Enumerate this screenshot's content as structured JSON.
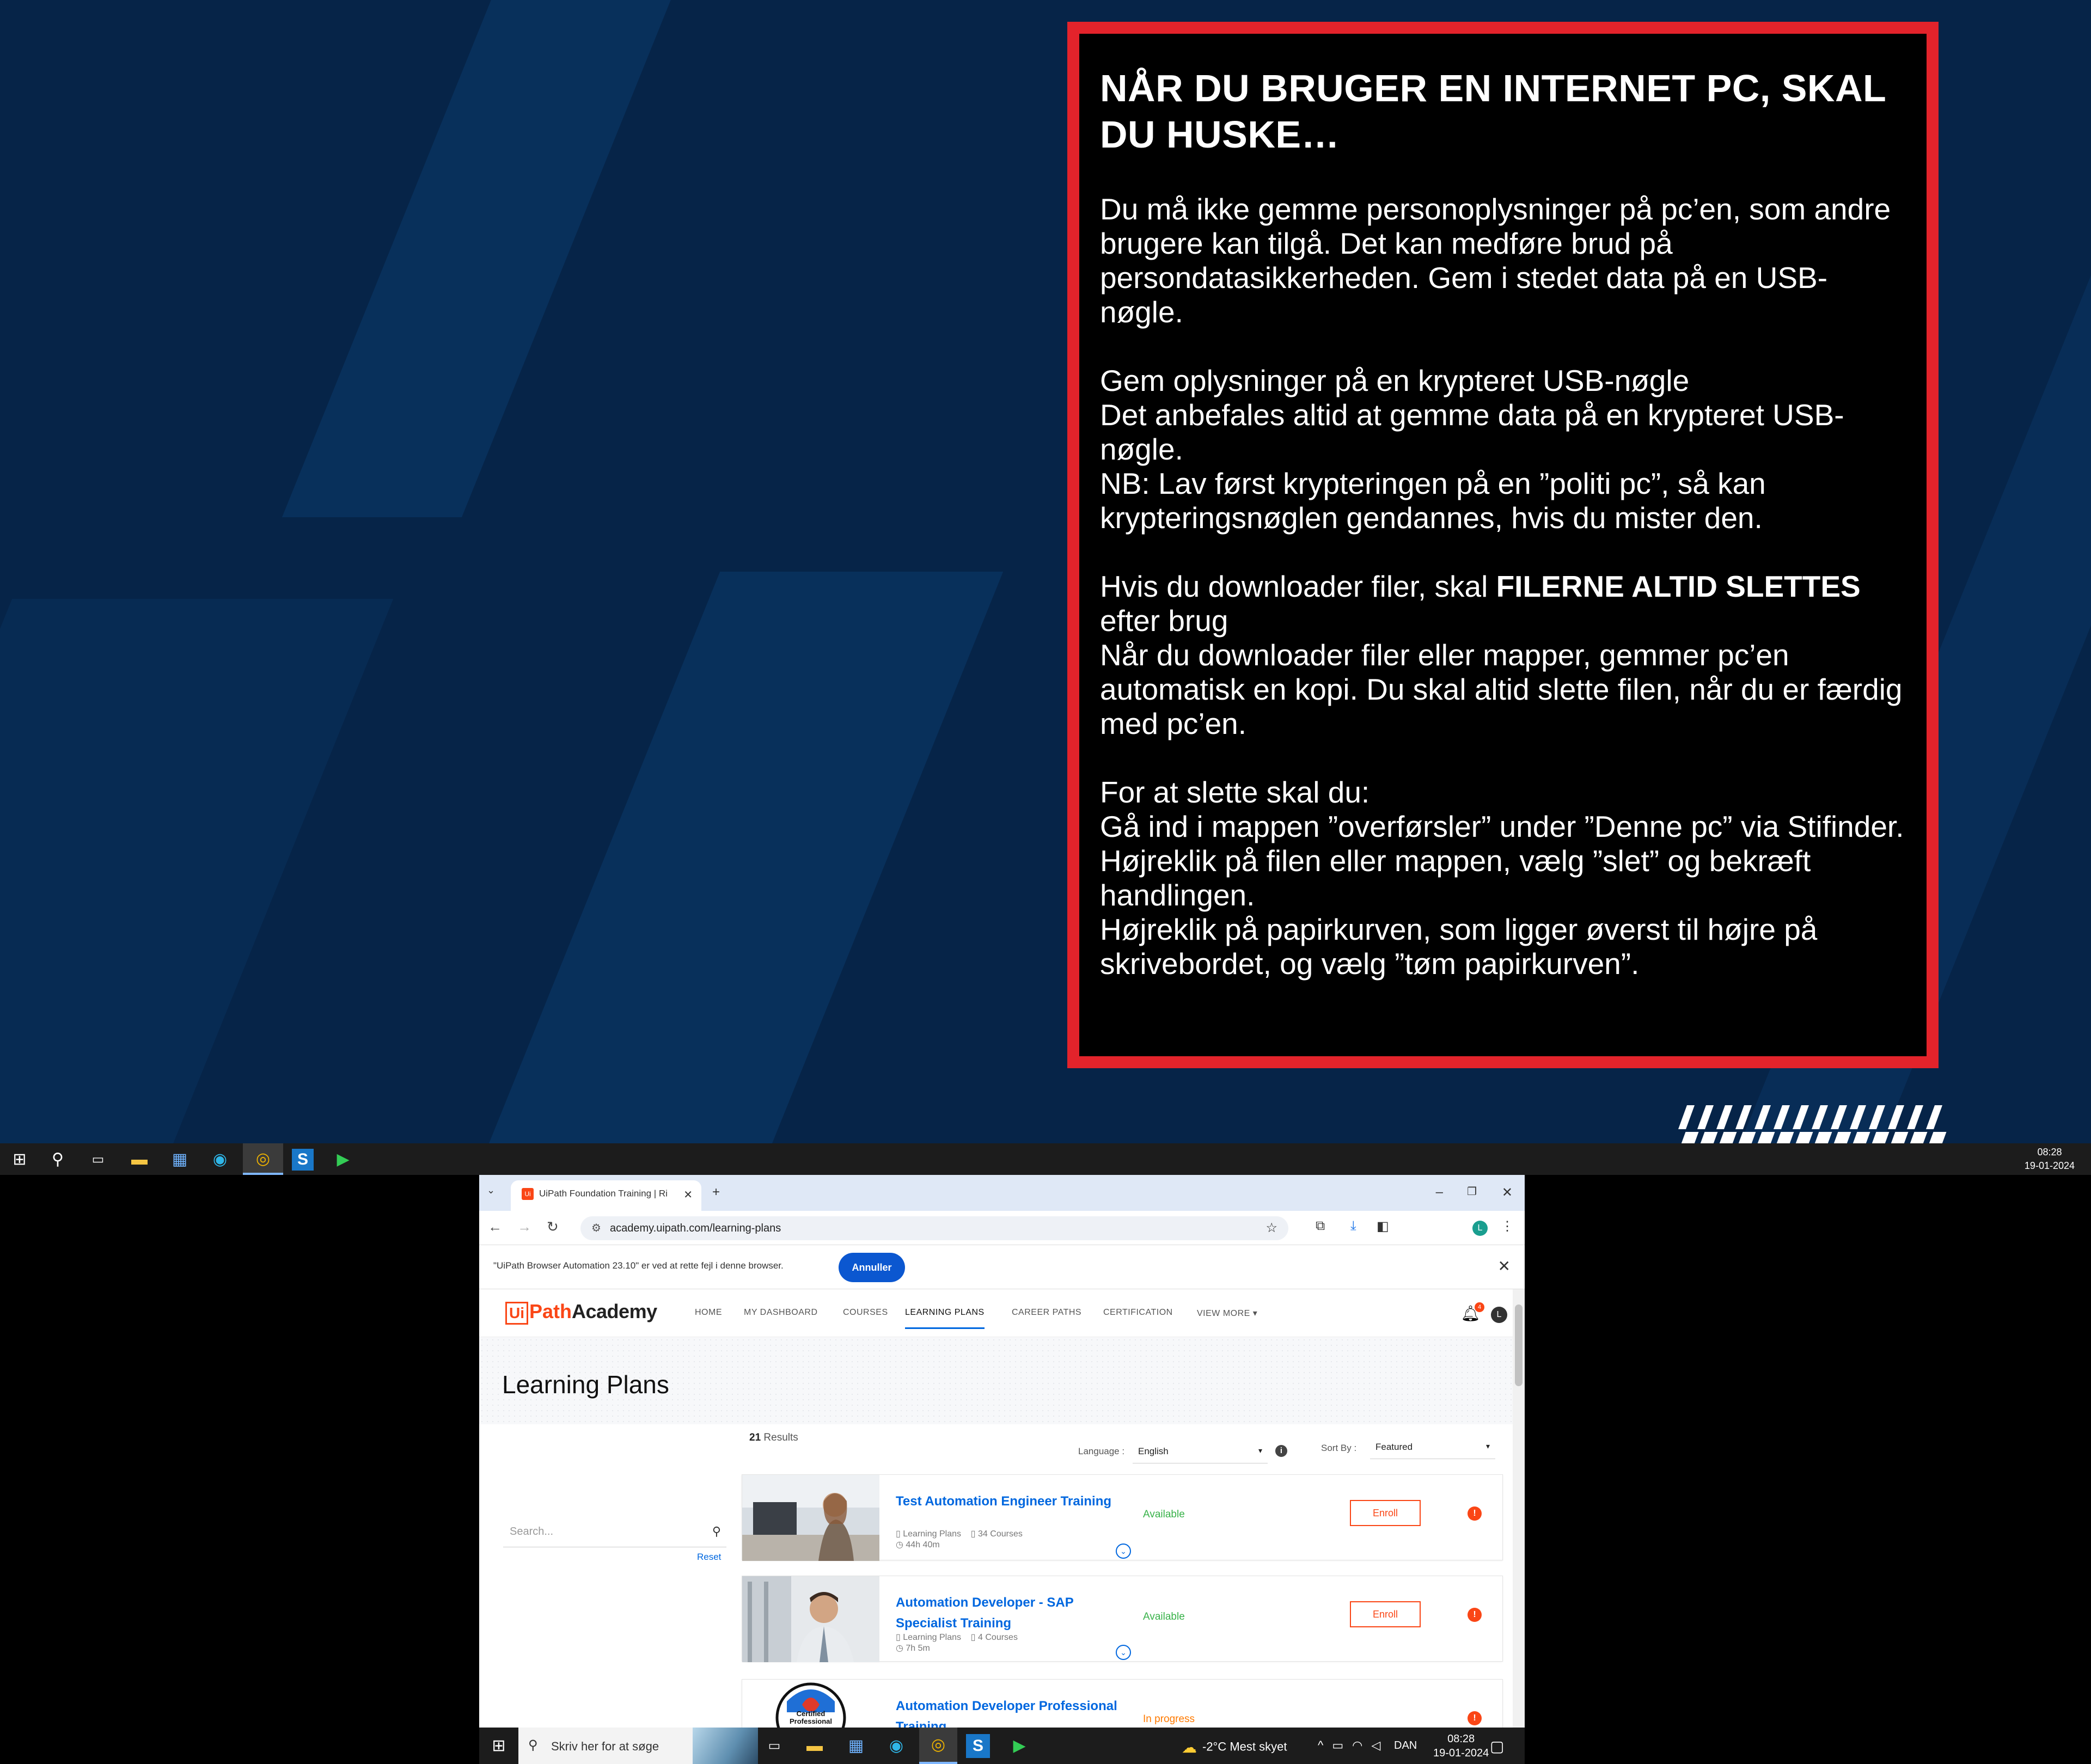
{
  "desktop_top": {
    "notice": {
      "title": "NÅR DU BRUGER EN INTERNET PC, SKAL DU HUSKE…",
      "p1": "Du må ikke gemme personoplysninger på pc’en, som andre brugere kan tilgå. Det kan medføre brud på persondatasikkerheden. Gem i stedet data på en USB-nøgle.",
      "p2_l1": "Gem oplysninger på en krypteret USB-nøgle",
      "p2_l2": "Det anbefales altid at gemme data på en krypteret USB-nøgle.",
      "p2_l3": "NB: Lav først krypteringen på en ”politi pc”, så kan krypteringsnøglen gendannes, hvis du mister den.",
      "p3_pre": "Hvis du downloader filer, skal ",
      "p3_bold": "FILERNE ALTID SLETTES",
      "p3_post": " efter brug",
      "p3_l2": "Når du downloader filer eller mapper, gemmer pc’en automatisk en kopi. Du skal altid slette filen, når du er færdig med pc’en.",
      "p4_l1": "For at slette skal du:",
      "p4_l2": "Gå ind i mappen ”overførsler” under ”Denne pc” via Stifinder.",
      "p4_l3": "Højreklik på filen eller mappen, vælg ”slet” og bekræft handlingen.",
      "p4_l4": "Højreklik på papirkurven, som ligger øverst til højre på skrivebordet, og vælg ”tøm papirkurven”."
    },
    "taskbar": {
      "icons": [
        "windows-icon",
        "search-icon",
        "task-view-icon",
        "file-explorer-icon",
        "store-icon",
        "edge-icon",
        "chrome-icon",
        "app-s-icon",
        "media-player-icon"
      ],
      "time": "08:28",
      "date": "19-01-2024"
    }
  },
  "browser": {
    "tab_title": "UiPath Foundation Training | Ri",
    "tab_favicon": "Ui",
    "new_tab": "+",
    "url": "academy.uipath.com/learning-plans",
    "profile_initial": "L",
    "infobar_text": "\"UiPath Browser Automation 23.10\" er ved at rette fejl i denne browser.",
    "infobar_button": "Annuller"
  },
  "site": {
    "logo_ui": "Ui",
    "logo_path": "Path",
    "logo_academy": "Academy",
    "nav": {
      "home": "HOME",
      "dashboard": "MY DASHBOARD",
      "courses": "COURSES",
      "learning_plans": "LEARNING PLANS",
      "career_paths": "CAREER PATHS",
      "certification": "CERTIFICATION",
      "view_more": "VIEW MORE ▾"
    },
    "notification_count": "4",
    "user_initial": "L",
    "page_title": "Learning Plans",
    "search_placeholder": "Search...",
    "reset": "Reset",
    "results_count": "21",
    "results_label": " Results",
    "language_label": "Language :",
    "language_value": "English",
    "sort_label": "Sort By :",
    "sort_value": "Featured",
    "cards": [
      {
        "title": "Test Automation Engineer Training",
        "type": "Learning Plans",
        "courses": "34 Courses",
        "duration": "44h 40m",
        "status": "Available",
        "action": "Enroll"
      },
      {
        "title": "Automation Developer - SAP Specialist Training",
        "type": "Learning Plans",
        "courses": "4 Courses",
        "duration": "7h 5m",
        "status": "Available",
        "action": "Enroll"
      },
      {
        "title": "Automation Developer Professional Training",
        "badge_text": "Certified Professional",
        "status": "In progress"
      }
    ]
  },
  "taskbar_bottom": {
    "search_placeholder": "Skriv her for at søge",
    "weather": "-2°C  Mest skyet",
    "lang": "DAN",
    "time": "08:28",
    "date": "19-01-2024"
  },
  "colors": {
    "wallpaper": "#062448",
    "notice_border": "#e3232b",
    "uipath_orange": "#fa4616",
    "link_blue": "#0067df",
    "available_green": "#38b249",
    "in_progress_orange": "#ff7a00"
  }
}
